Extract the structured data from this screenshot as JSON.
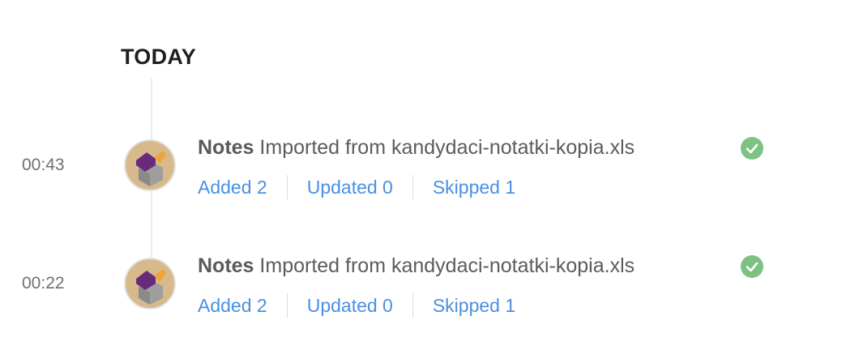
{
  "section": {
    "title": "TODAY"
  },
  "entries": [
    {
      "time": "00:43",
      "label": "Notes",
      "message": "Imported from kandydaci-notatki-kopia.xls",
      "status": "success",
      "added": "Added 2",
      "updated": "Updated 0",
      "skipped": "Skipped 1"
    },
    {
      "time": "00:22",
      "label": "Notes",
      "message": "Imported from kandydaci-notatki-kopia.xls",
      "status": "success",
      "added": "Added 2",
      "updated": "Updated 0",
      "skipped": "Skipped 1"
    }
  ],
  "colors": {
    "link": "#4a90e2",
    "success": "#7dc282",
    "avatar_bg": "#d8b98b"
  },
  "icons": {
    "avatar": "import-box-icon",
    "status": "check-circle-icon"
  }
}
